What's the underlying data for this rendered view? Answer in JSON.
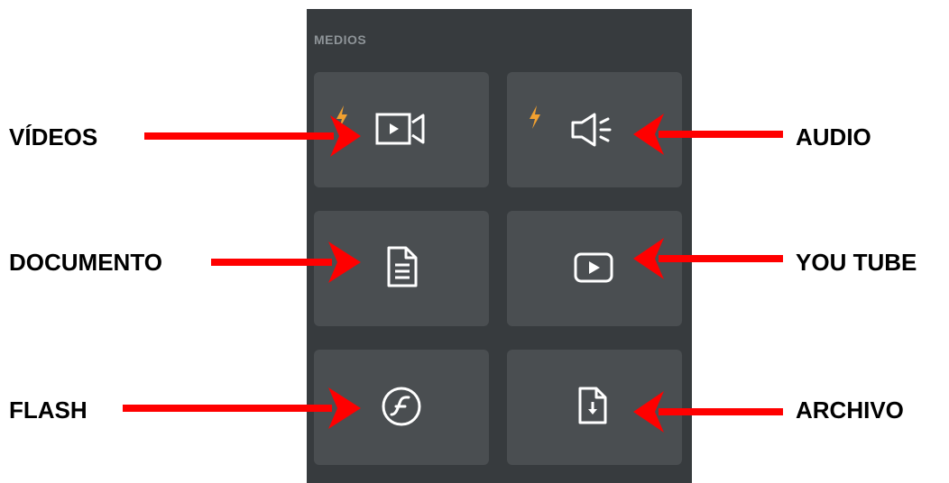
{
  "panel": {
    "title": "MEDIOS",
    "tiles": [
      {
        "name": "videos",
        "icon": "video-camera-icon",
        "badge": "lightning-icon"
      },
      {
        "name": "audio",
        "icon": "speaker-icon",
        "badge": "lightning-icon"
      },
      {
        "name": "document",
        "icon": "document-icon"
      },
      {
        "name": "youtube",
        "icon": "play-button-icon"
      },
      {
        "name": "flash",
        "icon": "flash-icon"
      },
      {
        "name": "file",
        "icon": "file-download-icon"
      }
    ]
  },
  "annotations": {
    "videos": "VÍDEOS",
    "audio": "AUDIO",
    "document": "DOCUMENTO",
    "youtube": "YOU TUBE",
    "flash": "FLASH",
    "file": "ARCHIVO"
  },
  "colors": {
    "panel_bg": "#373b3e",
    "tile_bg": "#4a4e51",
    "title": "#8e9498",
    "icon": "#ffffff",
    "badge": "#f0a030",
    "arrow": "#ff0000",
    "annotation_text": "#000000"
  }
}
